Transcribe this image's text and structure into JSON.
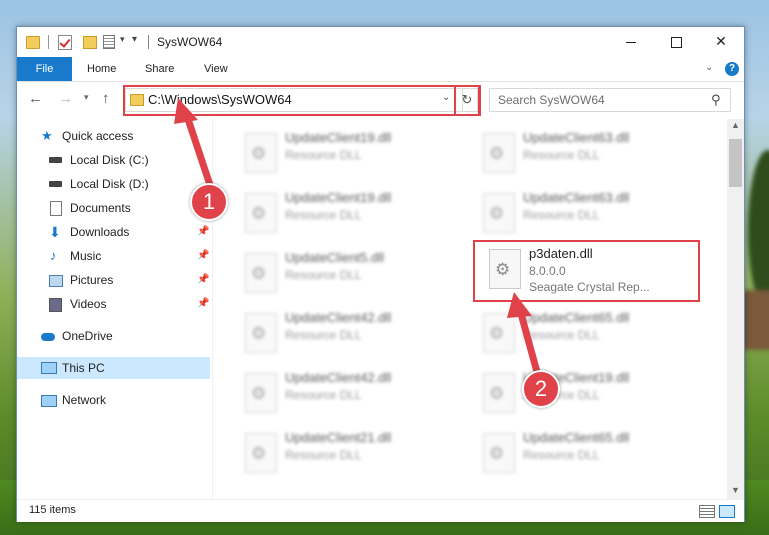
{
  "window": {
    "title": "SysWOW64"
  },
  "ribbon": {
    "file": "File",
    "home": "Home",
    "share": "Share",
    "view": "View",
    "help": "?"
  },
  "address": {
    "path": "C:\\Windows\\SysWOW64",
    "refresh_icon": "↻"
  },
  "search": {
    "placeholder": "Search SysWOW64"
  },
  "sidebar": {
    "items": [
      {
        "label": "Quick access",
        "icon": "star-icon"
      },
      {
        "label": "Local Disk (C:)",
        "icon": "drive-icon"
      },
      {
        "label": "Local Disk (D:)",
        "icon": "drive-icon"
      },
      {
        "label": "Documents",
        "icon": "documents-icon"
      },
      {
        "label": "Downloads",
        "icon": "download-icon",
        "pinned": true
      },
      {
        "label": "Music",
        "icon": "music-icon",
        "pinned": true
      },
      {
        "label": "Pictures",
        "icon": "pictures-icon",
        "pinned": true
      },
      {
        "label": "Videos",
        "icon": "videos-icon",
        "pinned": true
      },
      {
        "label": "OneDrive",
        "icon": "cloud-icon"
      },
      {
        "label": "This PC",
        "icon": "computer-icon",
        "selected": true
      },
      {
        "label": "Network",
        "icon": "network-icon"
      }
    ]
  },
  "files": [
    {
      "name": "UpdateClient19.dll",
      "line2": "Resource DLL"
    },
    {
      "name": "UpdateClient63.dll",
      "line2": "Resource DLL"
    },
    {
      "name": "UpdateClient19.dll",
      "line2": "Resource DLL"
    },
    {
      "name": "UpdateClient63.dll",
      "line2": "Resource DLL"
    },
    {
      "name": "UpdateClient5.dll",
      "line2": "Resource DLL"
    },
    {
      "name": "p3daten.dll",
      "line2": "8.0.0.0",
      "line3": "Seagate Crystal Rep..."
    },
    {
      "name": "UpdateClient42.dll",
      "line2": "Resource DLL"
    },
    {
      "name": "UpdateClient65.dll",
      "line2": "Resource DLL"
    },
    {
      "name": "UpdateClient42.dll",
      "line2": "Resource DLL"
    },
    {
      "name": "UpdateClient19.dll",
      "line2": "Resource DLL"
    },
    {
      "name": "UpdateClient21.dll",
      "line2": "Resource DLL"
    },
    {
      "name": "UpdateClient65.dll",
      "line2": "Resource DLL"
    }
  ],
  "status": {
    "count": "115 items"
  },
  "callouts": {
    "one": "1",
    "two": "2"
  },
  "colors": {
    "accent": "#1979ca",
    "highlight": "#e0424a",
    "selection": "#cce8ff"
  }
}
